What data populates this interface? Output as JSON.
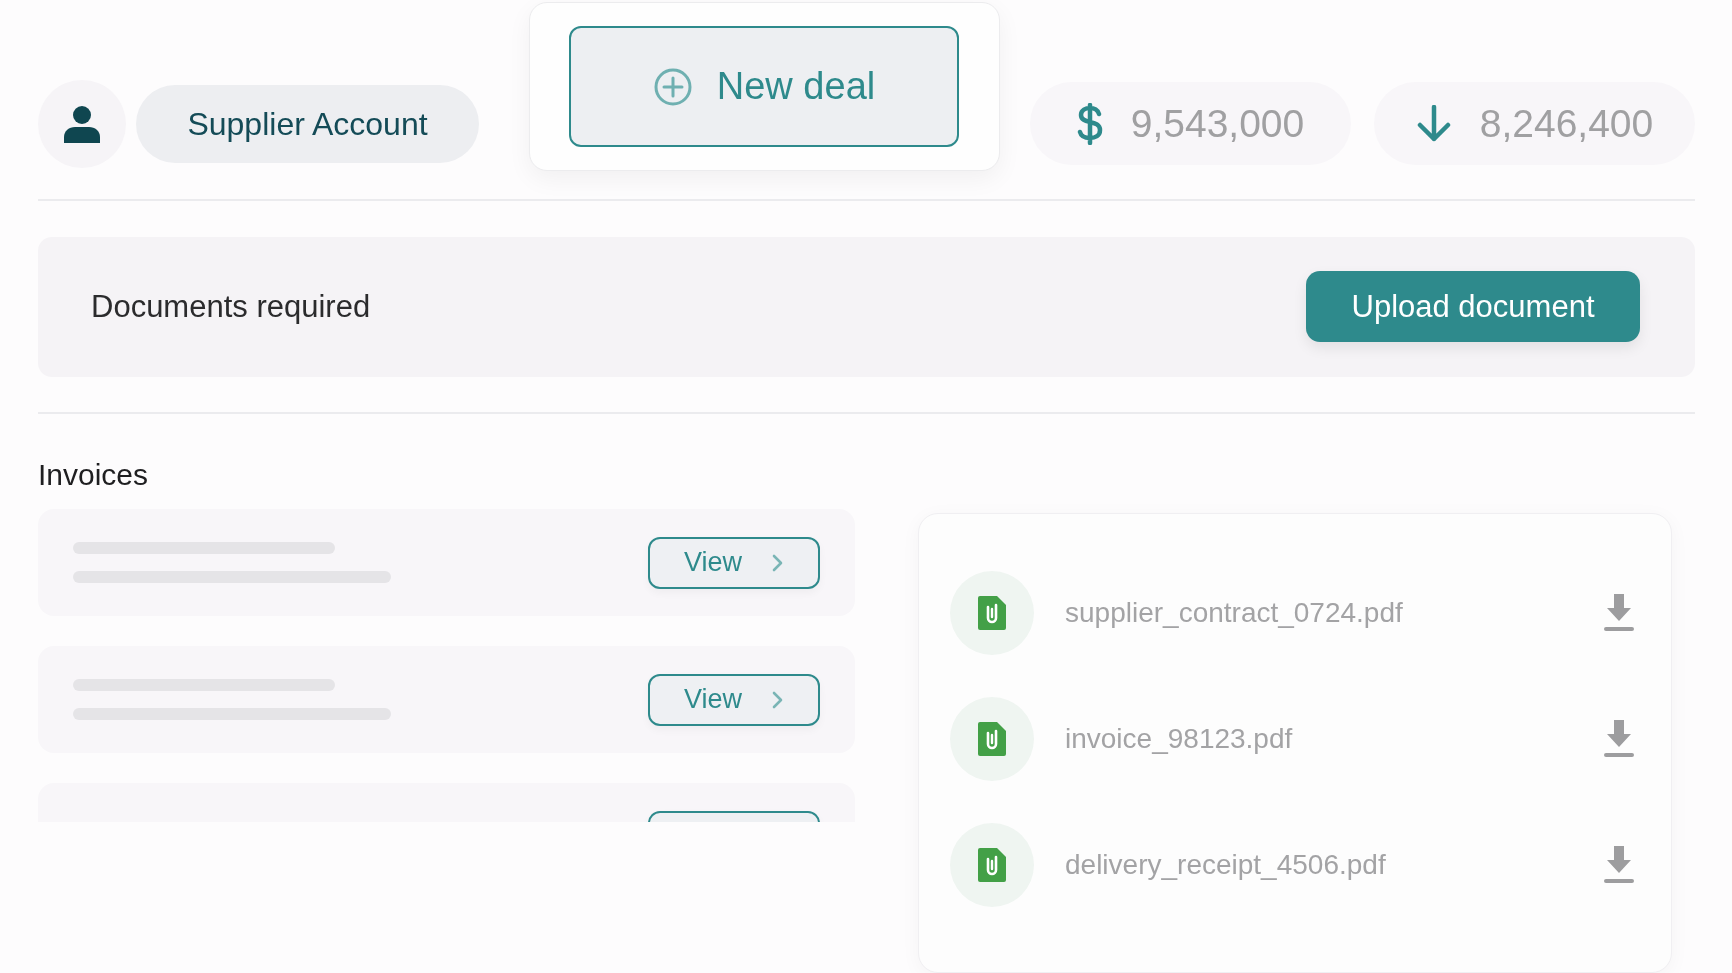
{
  "account": {
    "label": "Supplier Account"
  },
  "new_deal": {
    "label": "New deal"
  },
  "stats": [
    {
      "kind": "dollar",
      "value": "9,543,000"
    },
    {
      "kind": "down",
      "value": "8,246,400"
    }
  ],
  "documents_banner": {
    "text": "Documents required",
    "button": "Upload document"
  },
  "invoices": {
    "title": "Invoices",
    "rows": [
      {
        "button": "View"
      },
      {
        "button": "View"
      },
      {}
    ]
  },
  "files": [
    {
      "name": "supplier_contract_0724.pdf"
    },
    {
      "name": "invoice_98123.pdf"
    },
    {
      "name": "delivery_receipt_4506.pdf"
    }
  ]
}
